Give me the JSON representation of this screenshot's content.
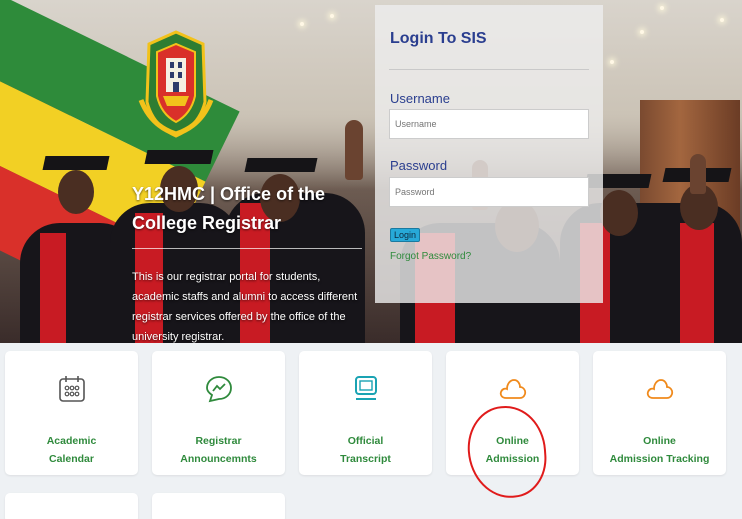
{
  "hero": {
    "title": "Y12HMC | Office of the College Registrar",
    "description": "This is our registrar portal for students, academic staffs and alumni to access different registrar services offered by the office of the university registrar."
  },
  "login": {
    "heading": "Login To SIS",
    "username_label": "Username",
    "username_placeholder": "Username",
    "password_label": "Password",
    "password_placeholder": "Password",
    "submit_label": "Login",
    "forgot_label": "Forgot Password?"
  },
  "cards": [
    {
      "line1": "Academic",
      "line2": "Calendar",
      "icon": "calendar-icon",
      "color": "#555555"
    },
    {
      "line1": "Registrar",
      "line2": "Announcemnts",
      "icon": "chat-chart-icon",
      "color": "#2f8a3c"
    },
    {
      "line1": "Official",
      "line2": "Transcript",
      "icon": "monitor-icon",
      "color": "#1aa3b3"
    },
    {
      "line1": "Online",
      "line2": "Admission",
      "icon": "cloud-icon",
      "color": "#f08a1c"
    },
    {
      "line1": "Online",
      "line2": "Admission Tracking",
      "icon": "cloud-icon",
      "color": "#f08a1c"
    }
  ],
  "colors": {
    "accent_green": "#2f8a3c",
    "login_heading": "#2a3e8f",
    "annotation_red": "#e01b1b"
  }
}
